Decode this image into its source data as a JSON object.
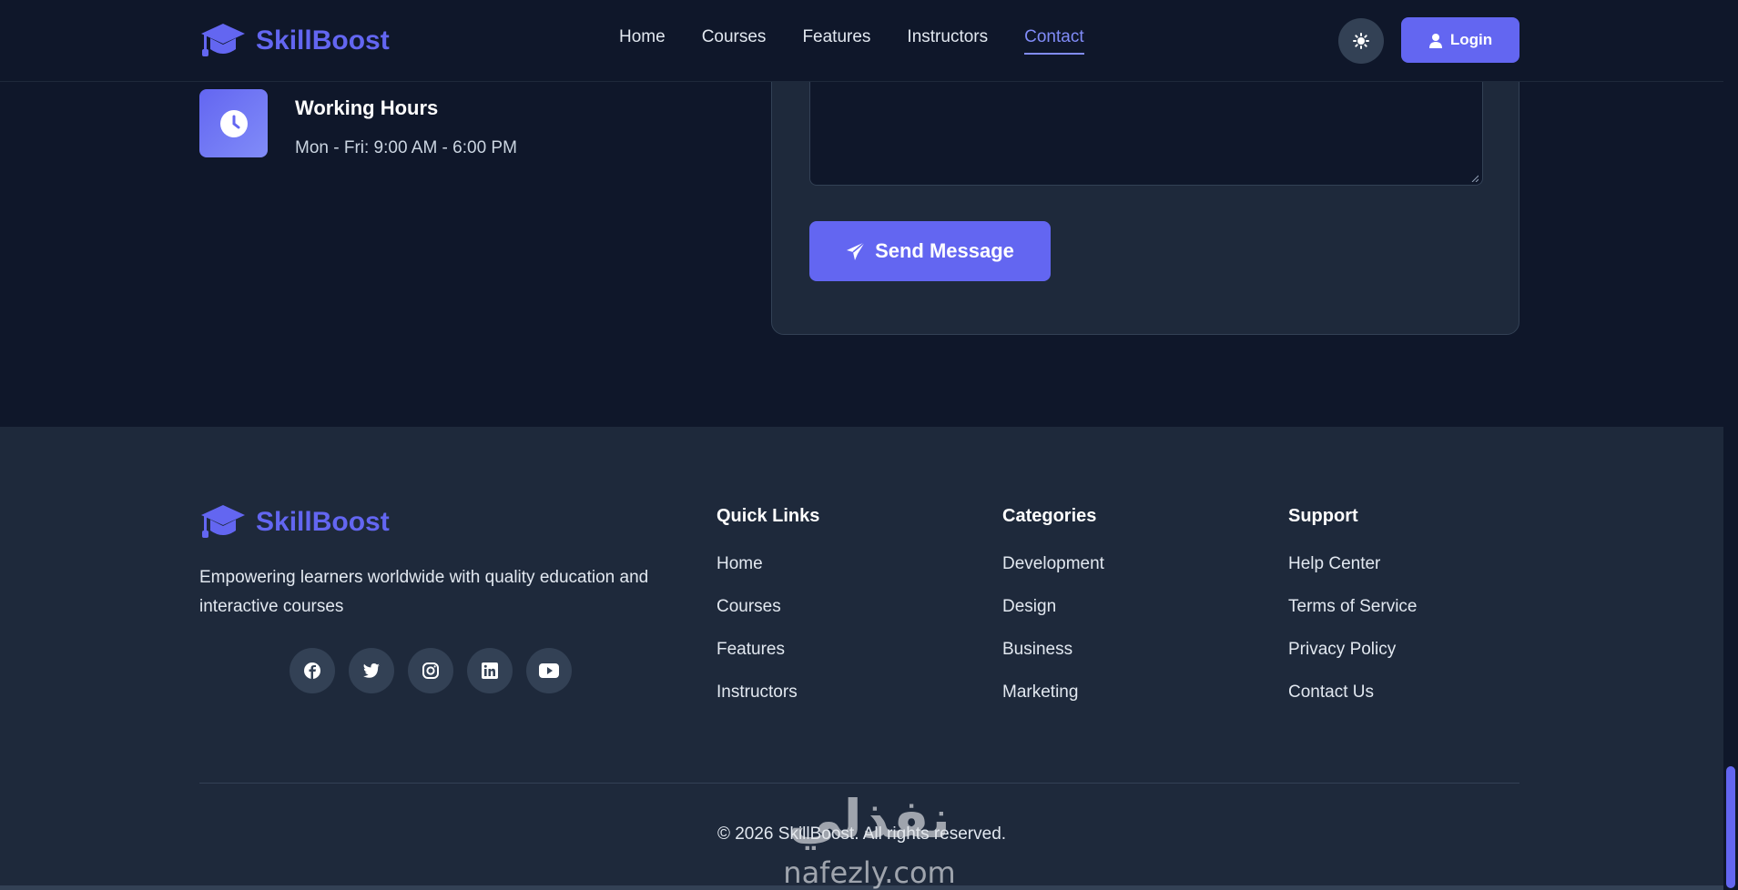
{
  "brand": {
    "name": "SkillBoost",
    "icon": "graduation-cap-icon",
    "color": "#6366f1"
  },
  "nav": {
    "links": [
      {
        "label": "Home",
        "active": false
      },
      {
        "label": "Courses",
        "active": false
      },
      {
        "label": "Features",
        "active": false
      },
      {
        "label": "Instructors",
        "active": false
      },
      {
        "label": "Contact",
        "active": true
      }
    ],
    "theme_icon": "sun-icon",
    "login_label": "Login",
    "login_icon": "user-icon"
  },
  "contact": {
    "working_hours": {
      "icon": "clock-icon",
      "title": "Working Hours",
      "text": "Mon - Fri: 9:00 AM - 6:00 PM"
    },
    "form": {
      "message_value": "",
      "send_label": "Send Message",
      "send_icon": "paper-plane-icon"
    }
  },
  "footer": {
    "brand": "SkillBoost",
    "description": "Empowering learners worldwide with quality education and interactive courses",
    "socials": [
      "facebook-icon",
      "twitter-icon",
      "instagram-icon",
      "linkedin-icon",
      "youtube-icon"
    ],
    "columns": [
      {
        "title": "Quick Links",
        "items": [
          "Home",
          "Courses",
          "Features",
          "Instructors"
        ]
      },
      {
        "title": "Categories",
        "items": [
          "Development",
          "Design",
          "Business",
          "Marketing"
        ]
      },
      {
        "title": "Support",
        "items": [
          "Help Center",
          "Terms of Service",
          "Privacy Policy",
          "Contact Us"
        ]
      }
    ],
    "copyright": "© 2026 SkillBoost. All rights reserved."
  },
  "watermark": {
    "arabic": "نفذلي",
    "latin": "nafezly.com"
  },
  "colors": {
    "accent": "#6366f1",
    "background": "#0f172a",
    "surface": "#1e293b",
    "active_link": "#818cf8"
  }
}
